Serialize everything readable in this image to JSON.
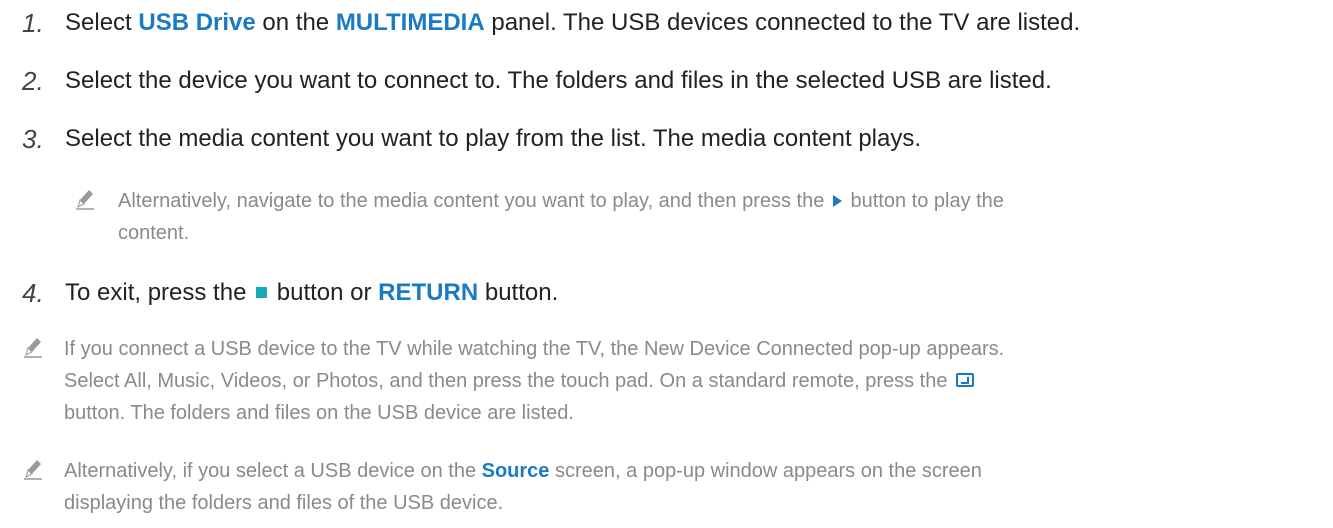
{
  "steps": [
    {
      "number": "1.",
      "parts": [
        "Select ",
        "USB Drive",
        " on the ",
        "MULTIMEDIA",
        " panel. The USB devices connected to the TV are listed."
      ]
    },
    {
      "number": "2.",
      "text": "Select the device you want to connect to. The folders and files in the selected USB are listed."
    },
    {
      "number": "3.",
      "text": "Select the media content you want to play from the list. The media content plays."
    },
    {
      "number": "4.",
      "parts": [
        "To exit, press the ",
        " button or ",
        "RETURN",
        " button."
      ]
    }
  ],
  "step3_note": {
    "line1_a": "Alternatively, navigate to the media content you want to play, and then press the ",
    "line1_b": " button to play the",
    "line2": "content."
  },
  "note_usb_connect": {
    "line1": "If you connect a USB device to the TV while watching the TV, the New Device Connected pop-up appears.",
    "line2_a": "Select All, Music, Videos, or Photos, and then press the touch pad. On a standard remote, press the ",
    "line3": "button. The folders and files on the USB device are listed."
  },
  "note_source": {
    "line1_a": "Alternatively, if you select a USB device on the ",
    "line1_hl": "Source",
    "line1_b": " screen, a pop-up window appears on the screen",
    "line2": "displaying the folders and files of the USB device."
  },
  "icons": {
    "note": "pencil-icon",
    "play": "play-icon",
    "stop": "stop-icon",
    "enter": "enter-icon"
  },
  "colors": {
    "highlight": "#1a7bc4",
    "stop_button": "#19a8b5",
    "note_text": "#8a8a8a"
  }
}
